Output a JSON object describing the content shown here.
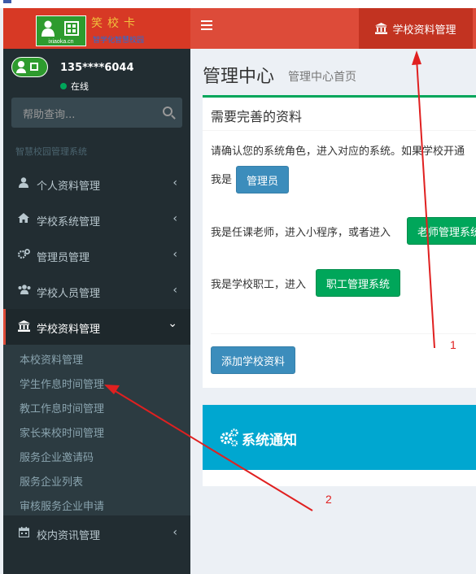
{
  "brand": {
    "name": "笑校卡",
    "domain": "ixiaoka.cn",
    "slogan": "智学化智慧校园"
  },
  "header": {
    "menu_icon": "hamburger-icon",
    "active_tab": "学校资料管理",
    "tab_icon": "bank-icon"
  },
  "user": {
    "name": "135****6044",
    "status": "在线",
    "status_color": "#00a65a"
  },
  "search": {
    "placeholder": "帮助查询..."
  },
  "sidebar": {
    "section_header": "智慧校园管理系统",
    "items": [
      {
        "label": "个人资料管理",
        "icon": "user-icon"
      },
      {
        "label": "学校系统管理",
        "icon": "home-icon"
      },
      {
        "label": "管理员管理",
        "icon": "gears-icon"
      },
      {
        "label": "学校人员管理",
        "icon": "users-icon"
      },
      {
        "label": "学校资料管理",
        "icon": "bank-icon",
        "active": true
      },
      {
        "label": "校内资讯管理",
        "icon": "calendar-icon"
      }
    ],
    "submenu": [
      "本校资料管理",
      "学生作息时间管理",
      "教工作息时间管理",
      "家长来校时间管理",
      "服务企业邀请码",
      "服务企业列表",
      "审核服务企业申请"
    ]
  },
  "content": {
    "title": "管理中心",
    "subtitle": "管理中心首页",
    "box1": {
      "title": "需要完善的资料",
      "intro": "请确认您的系统角色，进入对应的系统。如果学校开通",
      "admin_prefix": "我是",
      "admin_button": "管理员",
      "teacher_text": "我是任课老师，进入小程序，或者进入",
      "teacher_button": "老师管理系统",
      "staff_text": "我是学校职工，进入",
      "staff_button": "职工管理系统",
      "add_button": "添加学校资料"
    },
    "box2": {
      "title": "系统通知"
    }
  },
  "annotations": {
    "label1": "1",
    "label2": "2"
  },
  "colors": {
    "header": "#dd4b39",
    "sidebar": "#222d32",
    "primary": "#3c8dbc",
    "success": "#00a65a",
    "info": "#00a7d0",
    "annotation": "#e02020"
  }
}
